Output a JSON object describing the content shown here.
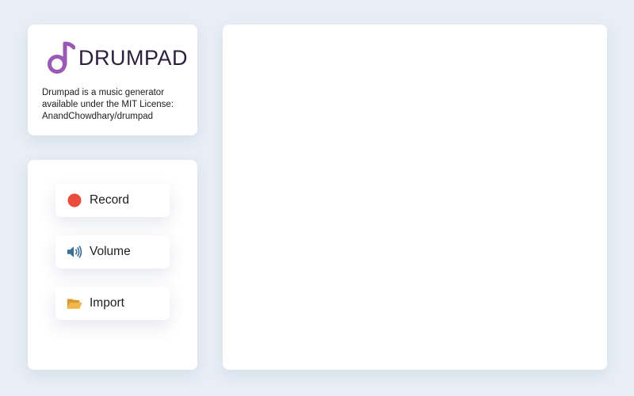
{
  "about": {
    "logo_text": "DRUMPAD",
    "description_lines": [
      "Drumpad is a music generator",
      "available under the MIT License:",
      "AnandChowdhary/drumpad"
    ]
  },
  "controls": {
    "record": {
      "label": "Record",
      "icon": "record-dot-icon"
    },
    "volume": {
      "label": "Volume",
      "icon": "speaker-icon"
    },
    "import": {
      "label": "Import",
      "icon": "open-folder-icon"
    }
  },
  "colors": {
    "background": "#e8eef6",
    "brand_purple": "#9b59b6",
    "record_red": "#e74c3c",
    "speaker_blue": "#3d6e94",
    "folder_yellow": "#e9a73c"
  }
}
